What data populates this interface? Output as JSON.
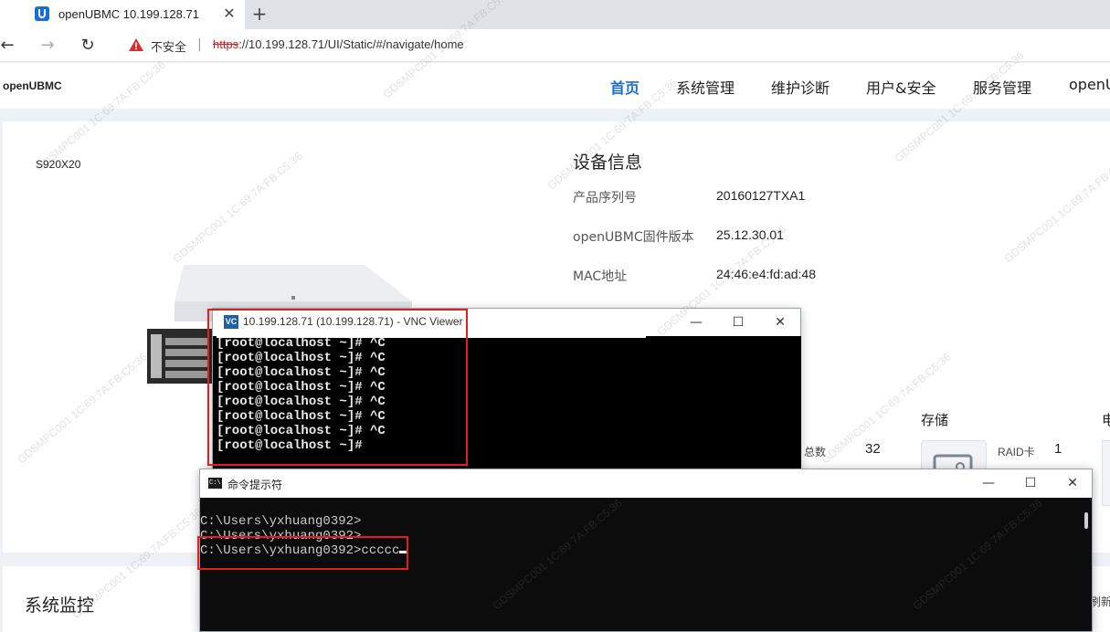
{
  "browser": {
    "tab_title": "openUBMC 10.199.128.71",
    "tab_close": "✕",
    "new_tab": "+",
    "insecure_label": "不安全",
    "url_scheme": "https",
    "url_rest": "://10.199.128.71/UI/Static/#/navigate/home"
  },
  "header": {
    "logo": "openUBMC",
    "menu": [
      "首页",
      "系统管理",
      "维护诊断",
      "用户&安全",
      "服务管理",
      "openU"
    ]
  },
  "device": {
    "model": "S920X20",
    "title": "设备信息",
    "fields": [
      {
        "label": "产品序列号",
        "value": "20160127TXA1"
      },
      {
        "label": "openUBMC固件版本",
        "value": "25.12.30.01"
      },
      {
        "label": "MAC地址",
        "value": "24:46:e4:fd:ad:48"
      }
    ]
  },
  "resources": {
    "storage_title": "存储",
    "other_title": "电",
    "total_label": "总数",
    "total_value": "32",
    "raid_label": "RAID卡",
    "raid_value": "1"
  },
  "monitor": {
    "title": "系统监控",
    "refresh": "刷新"
  },
  "vnc": {
    "icon_text": "VC",
    "title": "10.199.128.71 (10.199.128.71) - VNC Viewer",
    "lines": [
      "[root@localhost ~]# ^C",
      "[root@localhost ~]# ^C",
      "[root@localhost ~]# ^C",
      "[root@localhost ~]# ^C",
      "[root@localhost ~]# ^C",
      "[root@localhost ~]# ^C",
      "[root@localhost ~]# ^C",
      "[root@localhost ~]#"
    ]
  },
  "cmd": {
    "icon_text": "C:\\",
    "title": "命令提示符",
    "lines": [
      "C:\\Users\\yxhuang0392>",
      "C:\\Users\\yxhuang0392>",
      "C:\\Users\\yxhuang0392>ccccc"
    ]
  },
  "window_controls": {
    "minimize": "—",
    "maximize": "☐",
    "close": "✕"
  },
  "watermark": "GDSMPC001 1C:69:7A:FB:C5:36"
}
